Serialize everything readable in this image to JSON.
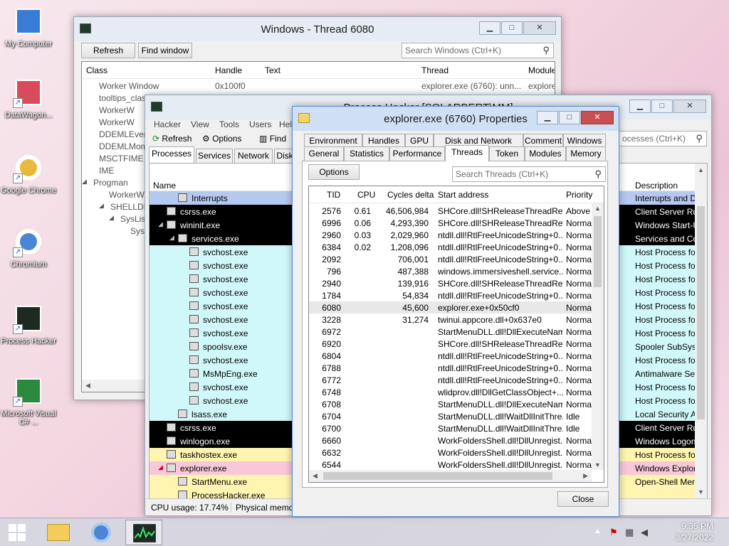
{
  "desktop": {
    "icons": [
      {
        "label": "My Computer",
        "icon": "computer-icon"
      },
      {
        "label": "DataWagon...",
        "icon": "datawagon-icon"
      },
      {
        "label": "Google Chrome",
        "icon": "chrome-icon"
      },
      {
        "label": "Chromium",
        "icon": "chromium-icon"
      },
      {
        "label": "Process Hacker",
        "icon": "process-hacker-icon"
      },
      {
        "label": "Microsoft Visual C# ...",
        "icon": "visual-csharp-icon"
      }
    ]
  },
  "windows_thread": {
    "title": "Windows - Thread 6080",
    "refresh_label": "Refresh",
    "find_label": "Find window",
    "search_placeholder": "Search Windows (Ctrl+K)",
    "columns": [
      "Class",
      "Handle",
      "Text",
      "Thread",
      "Module"
    ],
    "rows": [
      {
        "cls": "Worker Window",
        "handle": "0x100f0",
        "thread": "explorer.exe (6760): unn...",
        "module": "explore"
      },
      {
        "cls": "tooltips_class"
      },
      {
        "cls": "WorkerW"
      },
      {
        "cls": "WorkerW"
      },
      {
        "cls": "DDEMLEvent"
      },
      {
        "cls": "DDEMLMom"
      },
      {
        "cls": "MSCTFIME UI"
      },
      {
        "cls": "IME"
      },
      {
        "cls": "Progman"
      },
      {
        "cls": "WorkerW"
      },
      {
        "cls": "SHELLDLL_"
      },
      {
        "cls": "SysList"
      },
      {
        "cls": "Sys"
      }
    ]
  },
  "process_hacker": {
    "title": "Process Hacker [SOLARBERT\\MM]",
    "menu": [
      "Hacker",
      "View",
      "Tools",
      "Users",
      "Hel"
    ],
    "toolbar": {
      "refresh": "Refresh",
      "options": "Options",
      "find": "Find"
    },
    "search_placeholder": "ocesses (Ctrl+K)",
    "tabs": [
      "Processes",
      "Services",
      "Network",
      "Disk"
    ],
    "col_name": "Name",
    "col_description": "Description",
    "status_cpu": "CPU usage: 17.74%",
    "status_mem": "Physical memory",
    "processes": [
      {
        "name": "Interrupts",
        "indent": 2,
        "desc": "Interrupts and D",
        "color": "#b4c8f0",
        "text": "#000"
      },
      {
        "name": "csrss.exe",
        "indent": 1,
        "desc": "Client Server Run",
        "color": "#000000",
        "text": "#fff"
      },
      {
        "name": "wininit.exe",
        "indent": 1,
        "desc": "Windows Start-U",
        "color": "#000000",
        "text": "#fff"
      },
      {
        "name": "services.exe",
        "indent": 2,
        "desc": "Services and Co",
        "color": "#000000",
        "text": "#fff"
      },
      {
        "name": "svchost.exe",
        "indent": 3,
        "desc": "Host Process for",
        "color": "#d0f8f8",
        "text": "#000"
      },
      {
        "name": "svchost.exe",
        "indent": 3,
        "desc": "Host Process for",
        "color": "#d0f8f8",
        "text": "#000"
      },
      {
        "name": "svchost.exe",
        "indent": 3,
        "desc": "Host Process for",
        "color": "#d0f8f8",
        "text": "#000"
      },
      {
        "name": "svchost.exe",
        "indent": 3,
        "desc": "Host Process for",
        "color": "#d0f8f8",
        "text": "#000"
      },
      {
        "name": "svchost.exe",
        "indent": 3,
        "desc": "Host Process for",
        "color": "#d0f8f8",
        "text": "#000"
      },
      {
        "name": "svchost.exe",
        "indent": 3,
        "desc": "Host Process for",
        "color": "#d0f8f8",
        "text": "#000"
      },
      {
        "name": "svchost.exe",
        "indent": 3,
        "desc": "Host Process for",
        "color": "#d0f8f8",
        "text": "#000"
      },
      {
        "name": "spoolsv.exe",
        "indent": 3,
        "desc": "Spooler SubSyst",
        "color": "#d0f8f8",
        "text": "#000"
      },
      {
        "name": "svchost.exe",
        "indent": 3,
        "desc": "Host Process for",
        "color": "#d0f8f8",
        "text": "#000"
      },
      {
        "name": "MsMpEng.exe",
        "indent": 3,
        "desc": "Antimalware Ser",
        "color": "#d0f8f8",
        "text": "#000"
      },
      {
        "name": "svchost.exe",
        "indent": 3,
        "desc": "Host Process for",
        "color": "#d0f8f8",
        "text": "#000"
      },
      {
        "name": "svchost.exe",
        "indent": 3,
        "desc": "Host Process for",
        "color": "#d0f8f8",
        "text": "#000"
      },
      {
        "name": "lsass.exe",
        "indent": 2,
        "desc": "Local Security A",
        "color": "#d0f8f8",
        "text": "#000"
      },
      {
        "name": "csrss.exe",
        "indent": 1,
        "desc": "Client Server Run",
        "color": "#000000",
        "text": "#fff"
      },
      {
        "name": "winlogon.exe",
        "indent": 1,
        "desc": "Windows Logon",
        "color": "#000000",
        "text": "#fff"
      },
      {
        "name": "taskhostex.exe",
        "indent": 1,
        "desc": "Host Process for",
        "color": "#fff4b0",
        "text": "#000"
      },
      {
        "name": "explorer.exe",
        "indent": 1,
        "desc": "Windows Explor",
        "color": "#f8c8d8",
        "text": "#000"
      },
      {
        "name": "StartMenu.exe",
        "indent": 2,
        "desc": "Open-Shell Men",
        "color": "#fff4b0",
        "text": "#000"
      },
      {
        "name": "ProcessHacker.exe",
        "indent": 2,
        "desc": "",
        "color": "#fff4b0",
        "text": "#000"
      }
    ]
  },
  "properties": {
    "title": "explorer.exe (6760) Properties",
    "tabs_row1": [
      "Environment",
      "Handles",
      "GPU",
      "Disk and Network",
      "Comment",
      "Windows"
    ],
    "tabs_row2": [
      "General",
      "Statistics",
      "Performance",
      "Threads",
      "Token",
      "Modules",
      "Memory"
    ],
    "options_label": "Options",
    "search_placeholder": "Search Threads (Ctrl+K)",
    "columns": [
      "TID",
      "CPU",
      "Cycles delta",
      "Start address",
      "Priority"
    ],
    "threads": [
      {
        "tid": "2576",
        "cpu": "0.61",
        "cycles": "46,506,984",
        "addr": "SHCore.dll!SHReleaseThreadRef...",
        "prio": "Above n"
      },
      {
        "tid": "6996",
        "cpu": "0.06",
        "cycles": "4,293,390",
        "addr": "SHCore.dll!SHReleaseThreadRef...",
        "prio": "Normal"
      },
      {
        "tid": "2960",
        "cpu": "0.03",
        "cycles": "2,029,960",
        "addr": "ntdll.dll!RtlFreeUnicodeString+0...",
        "prio": "Normal"
      },
      {
        "tid": "6384",
        "cpu": "0.02",
        "cycles": "1,208,096",
        "addr": "ntdll.dll!RtlFreeUnicodeString+0...",
        "prio": "Normal"
      },
      {
        "tid": "2092",
        "cpu": "",
        "cycles": "706,001",
        "addr": "ntdll.dll!RtlFreeUnicodeString+0...",
        "prio": "Normal"
      },
      {
        "tid": "796",
        "cpu": "",
        "cycles": "487,388",
        "addr": "windows.immersiveshell.service....",
        "prio": "Normal"
      },
      {
        "tid": "2940",
        "cpu": "",
        "cycles": "139,916",
        "addr": "SHCore.dll!SHReleaseThreadRef...",
        "prio": "Normal"
      },
      {
        "tid": "1784",
        "cpu": "",
        "cycles": "54,834",
        "addr": "ntdll.dll!RtlFreeUnicodeString+0...",
        "prio": "Normal"
      },
      {
        "tid": "6080",
        "cpu": "",
        "cycles": "45,600",
        "addr": "explorer.exe+0x50cf0",
        "prio": "Normal"
      },
      {
        "tid": "3228",
        "cpu": "",
        "cycles": "31,274",
        "addr": "twinui.appcore.dll+0x637e0",
        "prio": "Normal"
      },
      {
        "tid": "6972",
        "cpu": "",
        "cycles": "",
        "addr": "StartMenuDLL.dll!DllExecuteNam...",
        "prio": "Normal"
      },
      {
        "tid": "6920",
        "cpu": "",
        "cycles": "",
        "addr": "SHCore.dll!SHReleaseThreadRef...",
        "prio": "Normal"
      },
      {
        "tid": "6804",
        "cpu": "",
        "cycles": "",
        "addr": "ntdll.dll!RtlFreeUnicodeString+0...",
        "prio": "Normal"
      },
      {
        "tid": "6788",
        "cpu": "",
        "cycles": "",
        "addr": "ntdll.dll!RtlFreeUnicodeString+0...",
        "prio": "Normal"
      },
      {
        "tid": "6772",
        "cpu": "",
        "cycles": "",
        "addr": "ntdll.dll!RtlFreeUnicodeString+0...",
        "prio": "Normal"
      },
      {
        "tid": "6748",
        "cpu": "",
        "cycles": "",
        "addr": "wlidprov.dll!DllGetClassObject+...",
        "prio": "Normal"
      },
      {
        "tid": "6708",
        "cpu": "",
        "cycles": "",
        "addr": "StartMenuDLL.dll!DllExecuteNam...",
        "prio": "Normal"
      },
      {
        "tid": "6704",
        "cpu": "",
        "cycles": "",
        "addr": "StartMenuDLL.dll!WaitDllInitThre...",
        "prio": "Idle"
      },
      {
        "tid": "6700",
        "cpu": "",
        "cycles": "",
        "addr": "StartMenuDLL.dll!WaitDllInitThre...",
        "prio": "Idle"
      },
      {
        "tid": "6660",
        "cpu": "",
        "cycles": "",
        "addr": "WorkFoldersShell.dll!DllUnregist...",
        "prio": "Normal"
      },
      {
        "tid": "6632",
        "cpu": "",
        "cycles": "",
        "addr": "WorkFoldersShell.dll!DllUnregist...",
        "prio": "Normal"
      },
      {
        "tid": "6544",
        "cpu": "",
        "cycles": "",
        "addr": "WorkFoldersShell.dll!DllUnregist...",
        "prio": "Normal"
      }
    ],
    "close_label": "Close"
  },
  "taskbar": {
    "time": "9:35 PM",
    "date": "3/27/2022"
  }
}
